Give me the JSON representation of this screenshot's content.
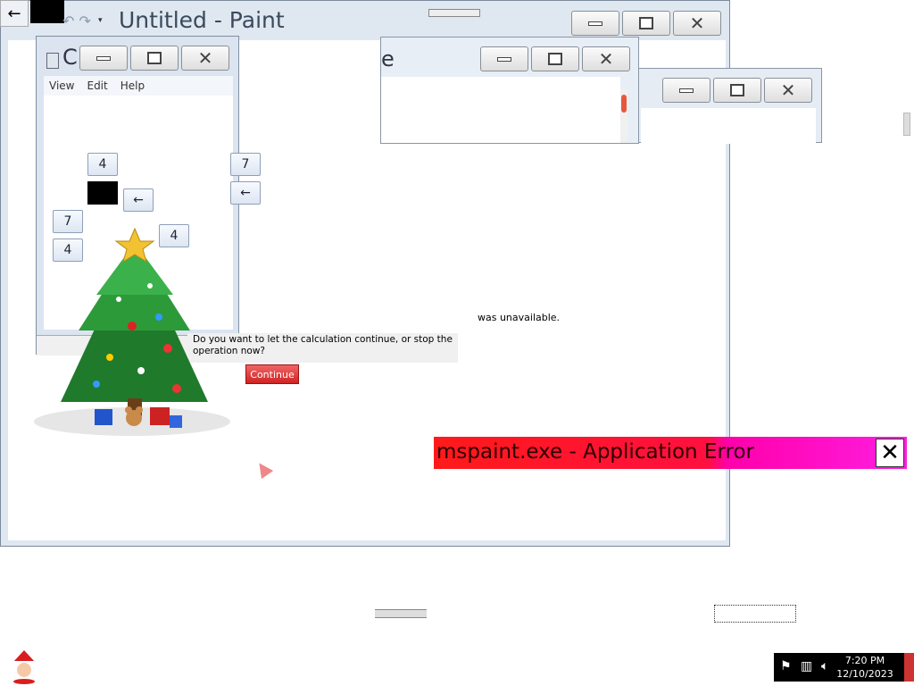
{
  "paint": {
    "title": "Untitled - Paint"
  },
  "mid_window": {
    "title_fragment": "e"
  },
  "calculator": {
    "title_fragment": "C",
    "menu": [
      "View",
      "Edit",
      "Help"
    ],
    "keys": {
      "k1": "4",
      "k2": "←",
      "k3": "7",
      "k4": "4",
      "k5": "4",
      "k6": "7",
      "k7": "←"
    }
  },
  "top_left": {
    "arrow": "←",
    "quick_access": "↶ ↷",
    "dropdown": "▾"
  },
  "dialog": {
    "question": "Do you want to let the calculation continue, or stop the operation now?",
    "continue_label": "Continue",
    "unavailable_text": "was unavailable."
  },
  "error": {
    "title": "mspaint.exe - Application Error",
    "close": "✕"
  },
  "caption": {
    "min": "",
    "max": "",
    "close": "✕"
  },
  "tray": {
    "time": "7:20 PM",
    "date": "12/10/2023"
  },
  "icons": {
    "tree": "christmas-tree-icon",
    "santa": "santa-icon",
    "flag": "flag-icon",
    "network": "network-icon",
    "volume": "volume-icon"
  },
  "colors": {
    "error_red": "#ff1a1a",
    "error_magenta": "#ff1ee0",
    "continue_red": "#d02222"
  }
}
